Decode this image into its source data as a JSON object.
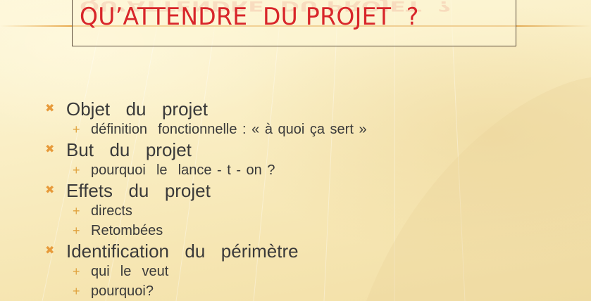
{
  "title": "QU’ATTENDRE  DU PROJET  ?",
  "colors": {
    "title": "#d8262a",
    "text": "#3a3a3a",
    "bullet": "#e79a3a",
    "background": "#faefc6"
  },
  "icons": {
    "main_bullet": "cross-bullet-icon",
    "sub_bullet": "plus-bullet-icon"
  },
  "bullet_glyphs": {
    "main": "✖",
    "sub": "+"
  },
  "items": [
    {
      "label": "Objet  du  projet",
      "subs": [
        "définition  fonctionnelle : « à quoi ça sert »"
      ]
    },
    {
      "label": "But  du  projet",
      "subs": [
        "pourquoi  le  lance - t - on ?"
      ]
    },
    {
      "label": "Effets  du  projet",
      "subs": [
        "directs",
        "Retombées"
      ]
    },
    {
      "label": "Identification  du  périmètre",
      "subs": [
        "qui  le  veut",
        "pourquoi?"
      ]
    }
  ]
}
